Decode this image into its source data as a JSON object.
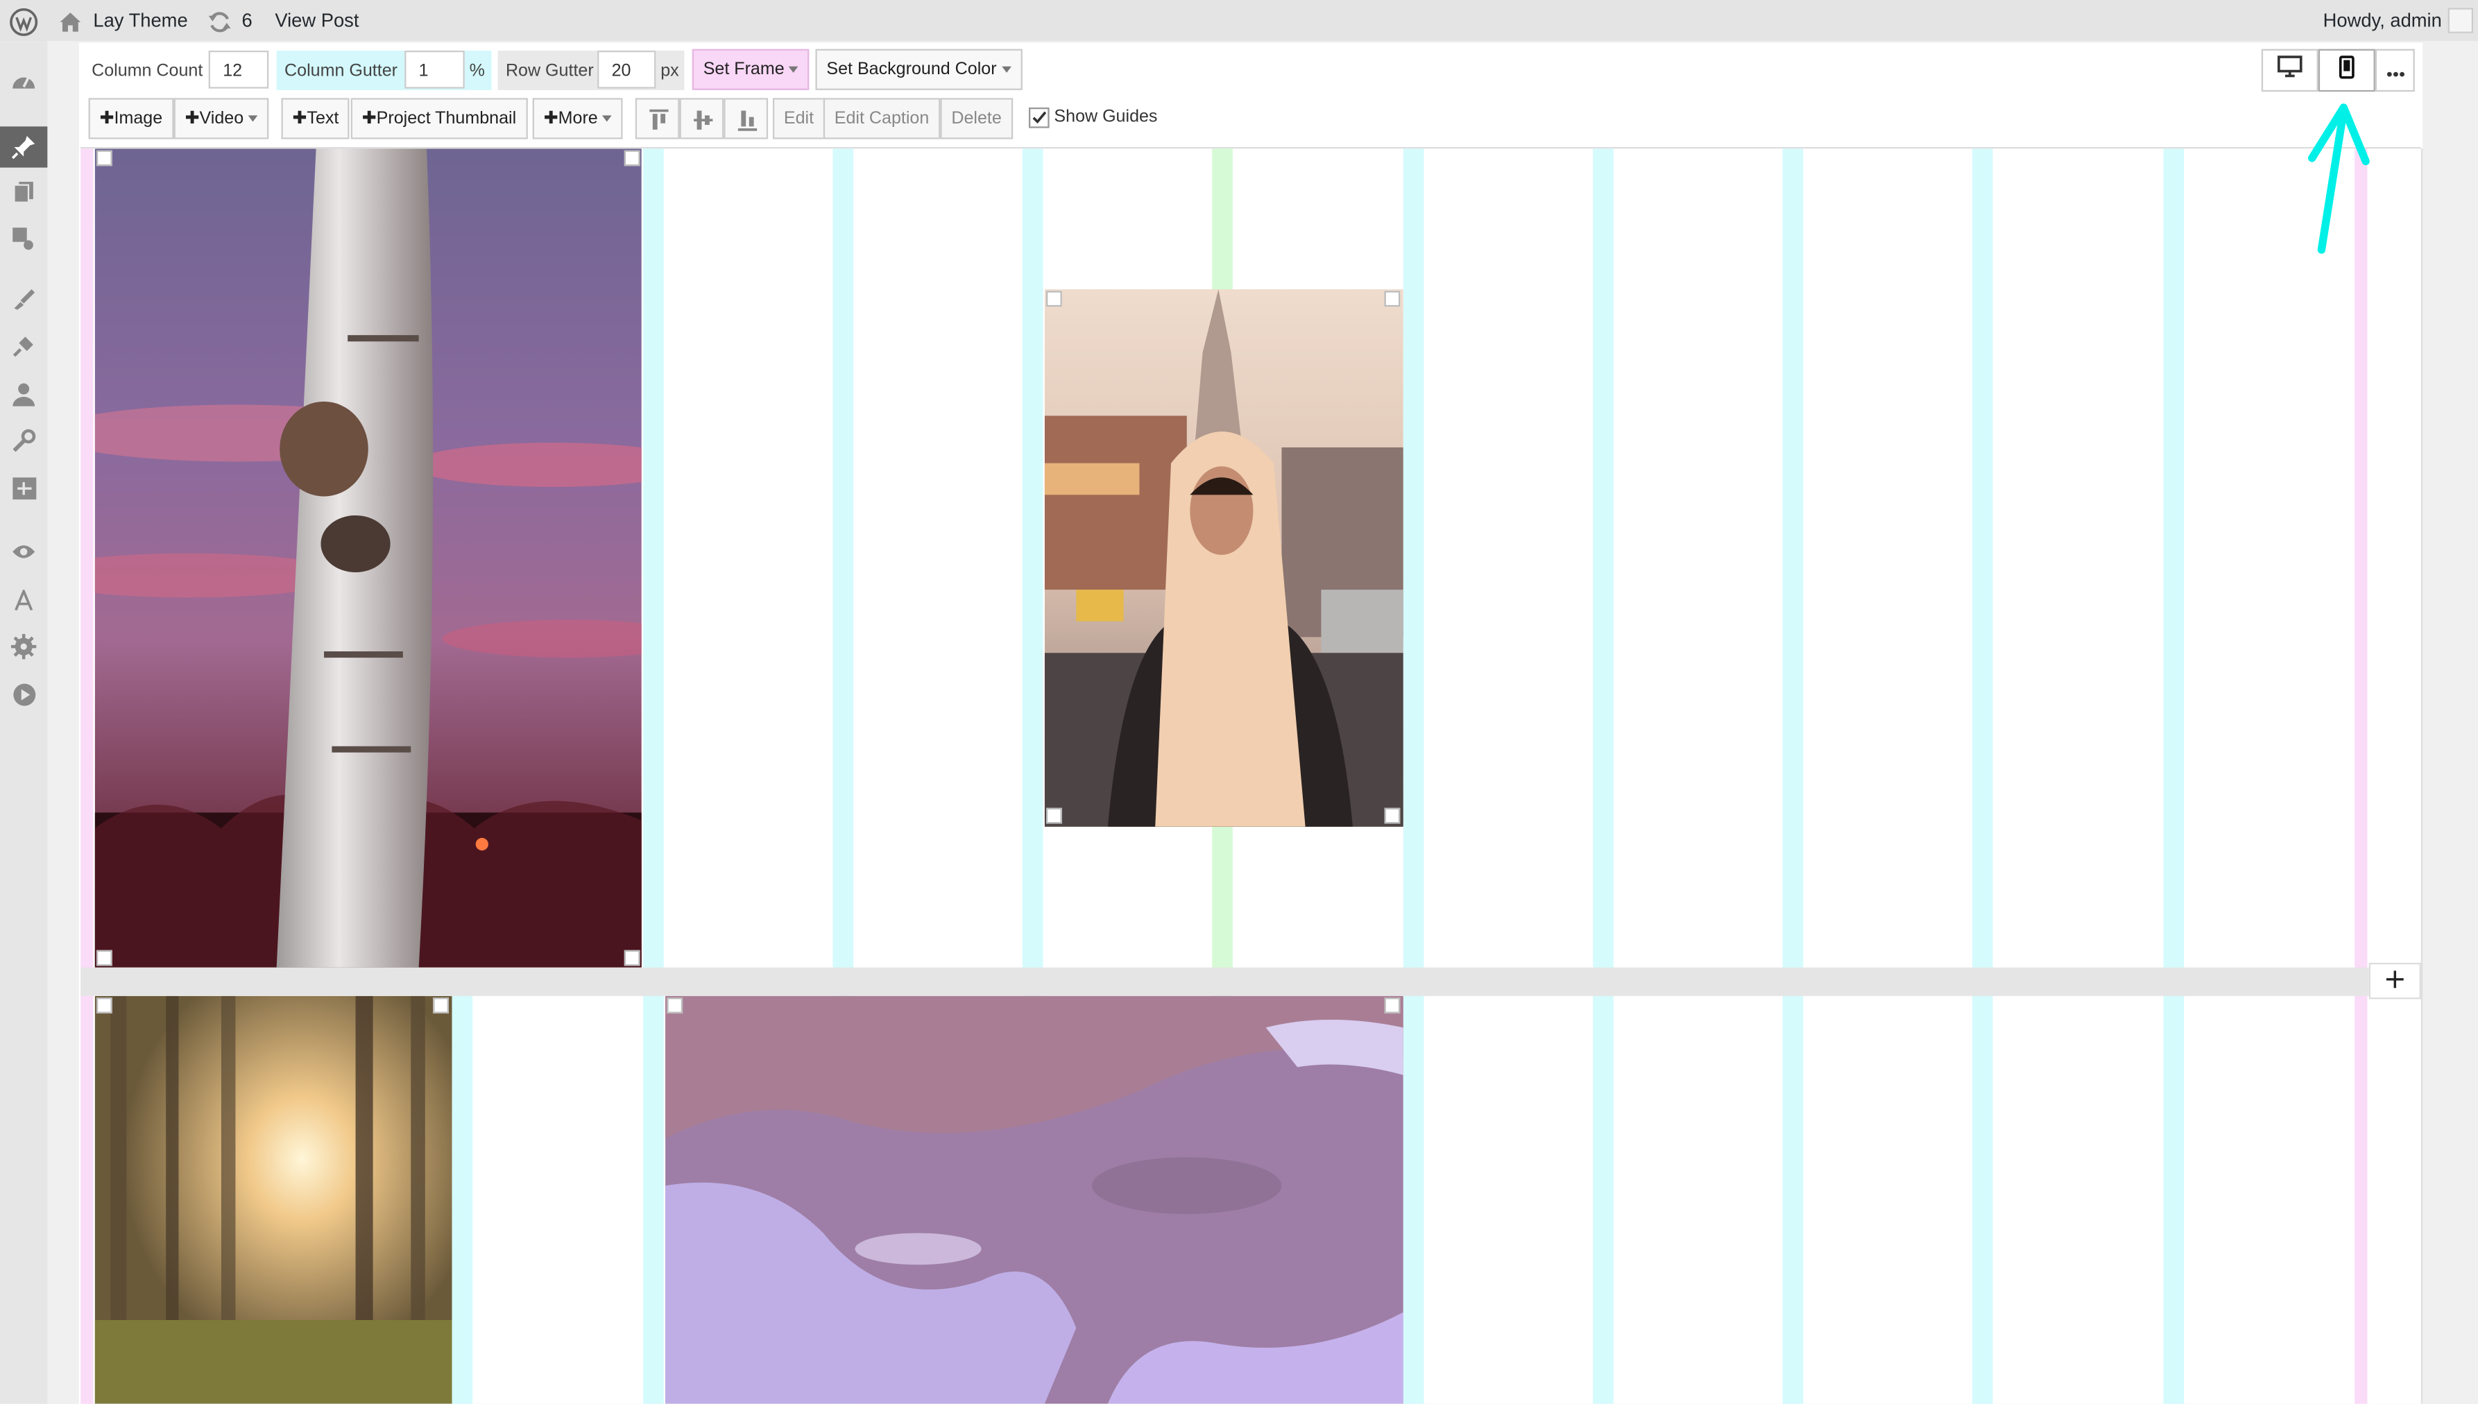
{
  "adminbar": {
    "site_name": "Lay Theme",
    "updates_count": "6",
    "view_post": "View Post",
    "howdy": "Howdy, admin"
  },
  "toolbar": {
    "column_count_label": "Column Count",
    "column_count_value": "12",
    "column_gutter_label": "Column Gutter",
    "column_gutter_value": "1",
    "column_gutter_unit": "%",
    "row_gutter_label": "Row Gutter",
    "row_gutter_value": "20",
    "row_gutter_unit": "px",
    "set_frame": "Set Frame",
    "set_bg_color": "Set Background Color",
    "add_image": "Image",
    "add_video": "Video",
    "add_text": "Text",
    "add_project_thumbnail": "Project Thumbnail",
    "add_more": "More",
    "edit": "Edit",
    "edit_caption": "Edit Caption",
    "delete": "Delete",
    "show_guides": "Show Guides"
  },
  "icons": {
    "wp_logo": "wordpress-icon",
    "home": "home-icon",
    "updates": "refresh-icon",
    "desktop": "desktop-icon",
    "phone": "phone-icon",
    "more": "ellipsis-icon",
    "add_row": "plus-icon"
  },
  "colors": {
    "annotation_arrow": "#00f0e8",
    "gutter": "#d5fbfd",
    "gutter_center": "#d6fad5",
    "frame": "#fadcf8",
    "gutter_field_bg": "#d4f8fb",
    "frame_button_bg": "#f9d7f6"
  }
}
